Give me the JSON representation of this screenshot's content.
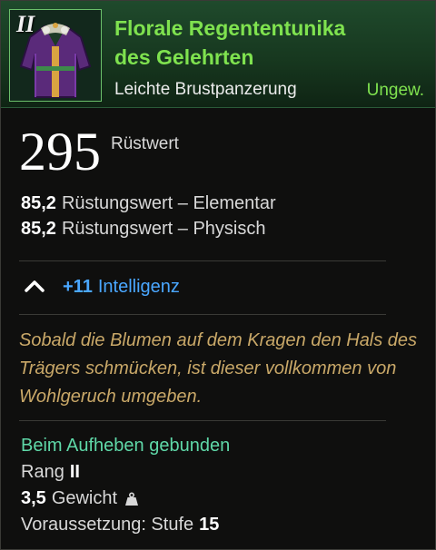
{
  "item": {
    "name_line1": "Florale Regententunika",
    "name_line2": "des Gelehrten",
    "type": "Leichte Brustpanzerung",
    "rarity": "Ungew.",
    "icon": "tunic-icon",
    "icon_rank_glyph": "II"
  },
  "armor": {
    "value": "295",
    "label": "Rüstwert"
  },
  "stats": [
    {
      "value": "85,2",
      "label": "Rüstungswert – Elementar"
    },
    {
      "value": "85,2",
      "label": "Rüstungswert – Physisch"
    }
  ],
  "bonus": {
    "icon": "chevron-up-icon",
    "value": "+11",
    "label": "Intelligenz"
  },
  "flavor_text": "Sobald die Blumen auf dem Kragen den Hals des Trägers schmücken, ist dieser vollkommen von Wohlgeruch umgeben.",
  "binding": "Beim Aufheben gebunden",
  "rank": {
    "label": "Rang",
    "value": "II"
  },
  "weight": {
    "value": "3,5",
    "label": "Gewicht",
    "icon": "weight-icon"
  },
  "requirement": {
    "label": "Voraussetzung: Stufe",
    "value": "15"
  },
  "colors": {
    "name": "#7fe24f",
    "rarity": "#7fe24f",
    "bonus": "#4aa7ff",
    "flavor": "#c9a868",
    "binding": "#5fd8a8",
    "header_bg": "#1f4a2c"
  }
}
